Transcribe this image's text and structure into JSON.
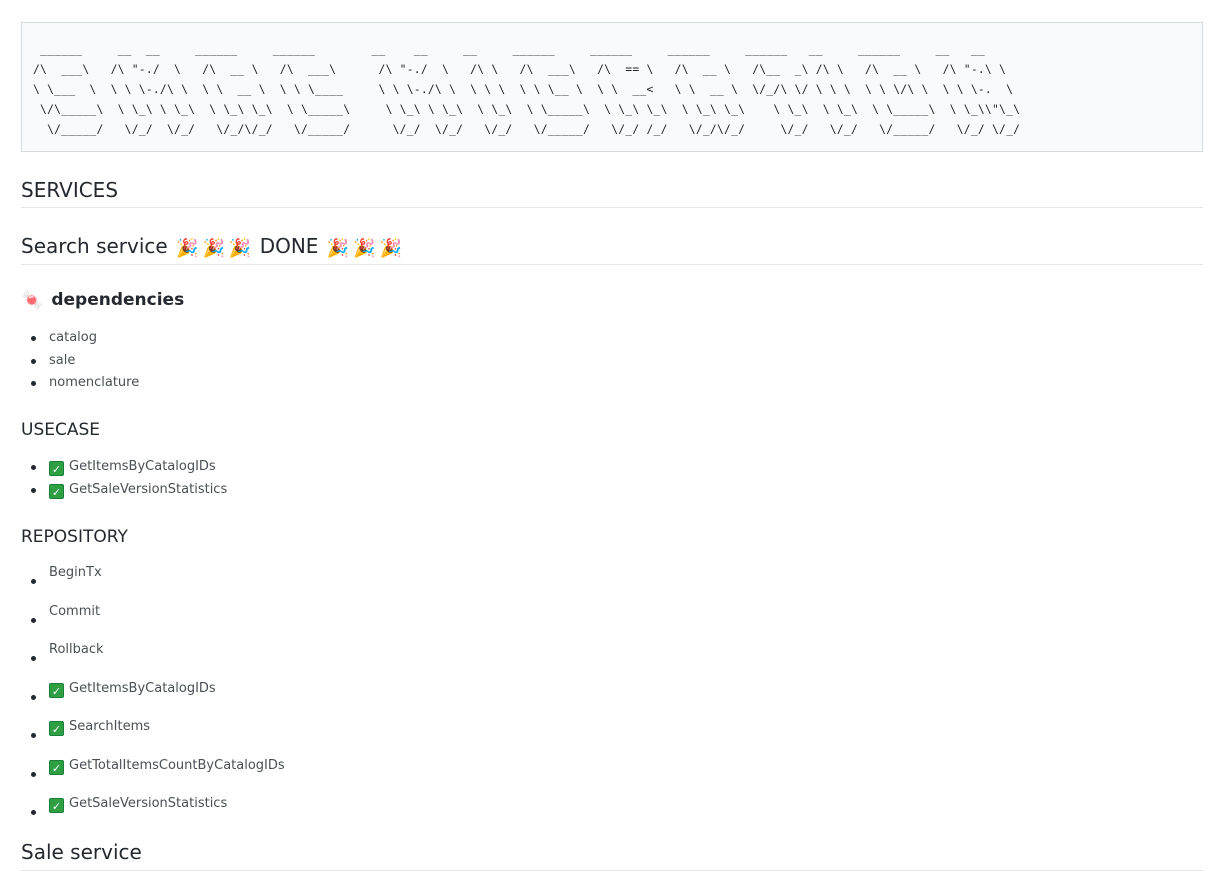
{
  "ascii_banner": " ______     __  __     ______     ______        __    __     __     ______     ______     ______     ______   __     ______     __   __\n/\\  ___\\   /\\ \"-./  \\   /\\  __ \\   /\\  ___\\      /\\ \"-./  \\   /\\ \\   /\\  ___\\   /\\  == \\   /\\  __ \\   /\\__  _\\ /\\ \\   /\\  __ \\   /\\ \"-.\\ \\\n\\ \\___  \\  \\ \\ \\-./\\ \\  \\ \\  __ \\  \\ \\ \\____     \\ \\ \\-./\\ \\  \\ \\ \\  \\ \\ \\__ \\  \\ \\  __<   \\ \\  __ \\  \\/_/\\ \\/ \\ \\ \\  \\ \\ \\/\\ \\  \\ \\ \\-.  \\\n \\/\\_____\\  \\ \\_\\ \\ \\_\\  \\ \\_\\ \\_\\  \\ \\_____\\     \\ \\_\\ \\ \\_\\  \\ \\_\\  \\ \\_____\\  \\ \\_\\ \\_\\  \\ \\_\\ \\_\\    \\ \\_\\  \\ \\_\\  \\ \\_____\\  \\ \\_\\\\\"\\_\\\n  \\/_____/   \\/_/  \\/_/   \\/_/\\/_/   \\/_____/      \\/_/  \\/_/   \\/_/   \\/_____/   \\/_/ /_/   \\/_/\\/_/     \\/_/   \\/_/   \\/_____/   \\/_/ \\/_/",
  "headings": {
    "services": "SERVICES",
    "search_service": "Search service",
    "done": "DONE",
    "dependencies": "dependencies",
    "usecase": "USECASE",
    "repository": "REPOSITORY",
    "sale_service": "Sale service"
  },
  "icons": {
    "party": "🎉",
    "candy": "🍬",
    "check": "✓"
  },
  "dependencies": [
    "catalog",
    "sale",
    "nomenclature"
  ],
  "usecases": [
    {
      "label": "GetItemsByCatalogIDs",
      "done": true
    },
    {
      "label": "GetSaleVersionStatistics",
      "done": true
    }
  ],
  "repository": [
    {
      "label": "BeginTx",
      "done": false
    },
    {
      "label": "Commit",
      "done": false
    },
    {
      "label": "Rollback",
      "done": false
    },
    {
      "label": "GetItemsByCatalogIDs",
      "done": true
    },
    {
      "label": "SearchItems",
      "done": true
    },
    {
      "label": "GetTotalItemsCountByCatalogIDs",
      "done": true
    },
    {
      "label": "GetSaleVersionStatistics",
      "done": true
    }
  ],
  "colors": {
    "check_bg": "#2ea043",
    "text": "#24292f"
  }
}
